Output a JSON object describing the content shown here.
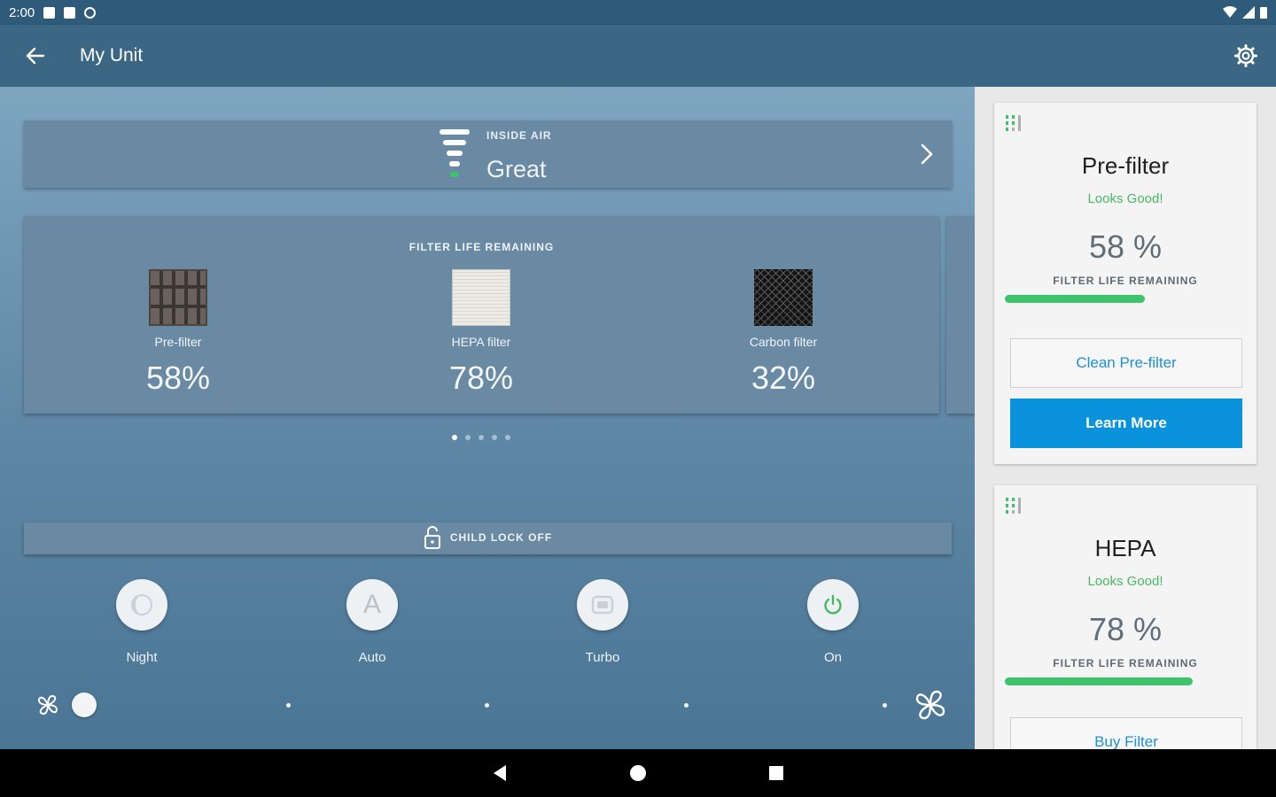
{
  "status_bar": {
    "time": "2:00"
  },
  "app_bar": {
    "title": "My Unit"
  },
  "inside_air": {
    "label": "INSIDE AIR",
    "value": "Great"
  },
  "filter_life": {
    "title": "FILTER LIFE REMAINING",
    "filters": [
      {
        "name": "Pre-filter",
        "percent": "58%"
      },
      {
        "name": "HEPA filter",
        "percent": "78%"
      },
      {
        "name": "Carbon filter",
        "percent": "32%"
      }
    ],
    "page_count": 5,
    "active_page": 1
  },
  "child_lock": {
    "label": "CHILD LOCK OFF"
  },
  "modes": [
    {
      "label": "Night",
      "icon": "night-icon"
    },
    {
      "label": "Auto",
      "icon": "auto-icon",
      "glyph": "A"
    },
    {
      "label": "Turbo",
      "icon": "turbo-icon"
    },
    {
      "label": "On",
      "icon": "power-icon",
      "accent": "#49b862"
    }
  ],
  "fan_speed": {
    "level": 1,
    "levels": 5
  },
  "side_cards": [
    {
      "title": "Pre-filter",
      "status": "Looks Good!",
      "percent": "58 %",
      "sub": "FILTER LIFE REMAINING",
      "fraction": 0.58,
      "primary_button": "Clean Pre-filter",
      "secondary_button": "Learn More"
    },
    {
      "title": "HEPA",
      "status": "Looks Good!",
      "percent": "78 %",
      "sub": "FILTER LIFE REMAINING",
      "fraction": 0.78,
      "primary_button": "Buy Filter"
    }
  ],
  "colors": {
    "accent_blue": "#0a93dc",
    "status_green": "#49b862",
    "bar_green": "#3cc36b",
    "header": "#3b6785"
  }
}
